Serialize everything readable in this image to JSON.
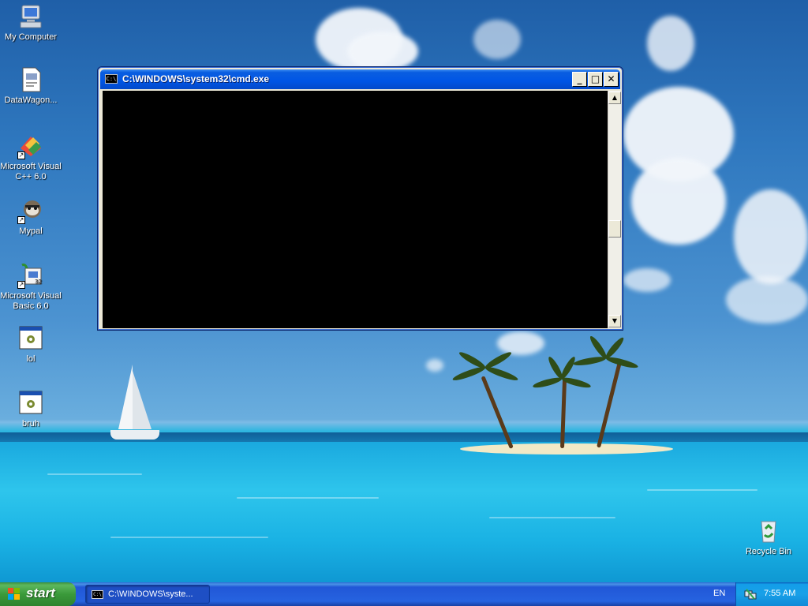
{
  "desktop": {
    "icons": [
      {
        "label": "My Computer",
        "icon": "computer-icon"
      },
      {
        "label": "DataWagon...",
        "icon": "document-icon"
      },
      {
        "label": "Microsoft Visual C++ 6.0",
        "icon": "visual-cpp-icon"
      },
      {
        "label": "Mypal",
        "icon": "mypal-browser-icon"
      },
      {
        "label": "Microsoft Visual Basic 6.0",
        "icon": "visual-basic-icon"
      },
      {
        "label": "lol",
        "icon": "program-icon"
      },
      {
        "label": "bruh",
        "icon": "program-icon"
      },
      {
        "label": "Recycle Bin",
        "icon": "recycle-bin-icon"
      }
    ]
  },
  "window": {
    "title": "C:\\WINDOWS\\system32\\cmd.exe",
    "icon_text": "C:\\",
    "console_text": ""
  },
  "taskbar": {
    "start_label": "start",
    "task_label": "C:\\WINDOWS\\syste...",
    "language": "EN",
    "clock": "7:55 AM"
  },
  "colors": {
    "titlebar": "#0055e5",
    "taskbar": "#2663e0",
    "start_green": "#3a9a3a",
    "console_bg": "#000000"
  }
}
